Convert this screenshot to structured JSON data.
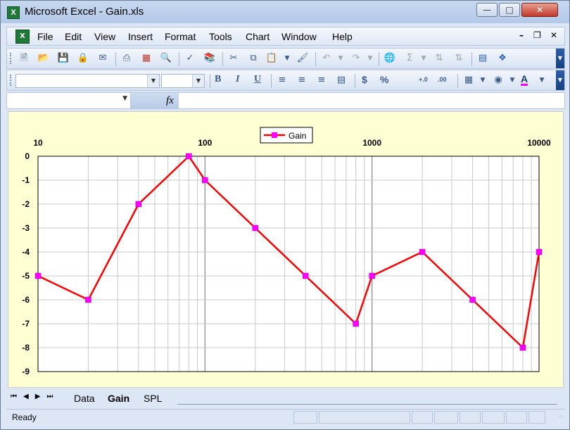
{
  "window": {
    "title": "Microsoft Excel - Gain.xls",
    "app_icon": "X"
  },
  "menu": [
    "File",
    "Edit",
    "View",
    "Insert",
    "Format",
    "Tools",
    "Chart",
    "Window",
    "Help"
  ],
  "formatting": {
    "bold": "B",
    "italic": "I",
    "underline": "U",
    "currency": "$",
    "percent": "%",
    "inc_decimal": "+.0",
    "dec_decimal": ".00",
    "font_color_glyph": "A"
  },
  "formula_bar": {
    "fx": "fx"
  },
  "chart_data": {
    "type": "line",
    "x_scale": "log",
    "xlim": [
      10,
      10000
    ],
    "ylim": [
      -9,
      0
    ],
    "x_tick_labels": [
      "10",
      "100",
      "1000",
      "10000"
    ],
    "y_tick_labels": [
      "0",
      "-1",
      "-2",
      "-3",
      "-4",
      "-5",
      "-6",
      "-7",
      "-8",
      "-9"
    ],
    "legend": {
      "placement": "top-center"
    },
    "grid": true,
    "series": [
      {
        "name": "Gain",
        "color": "#ff0000",
        "marker_color": "#ff00ff",
        "x": [
          10,
          20,
          40,
          80,
          100,
          200,
          400,
          800,
          1000,
          2000,
          4000,
          8000,
          10000
        ],
        "y": [
          -5,
          -6,
          -2,
          0,
          -1,
          -3,
          -5,
          -7,
          -5,
          -4,
          -6,
          -8,
          -4
        ]
      }
    ]
  },
  "sheets": [
    {
      "name": "Data",
      "active": false
    },
    {
      "name": "Gain",
      "active": true
    },
    {
      "name": "SPL",
      "active": false
    }
  ],
  "status": {
    "text": "Ready"
  }
}
